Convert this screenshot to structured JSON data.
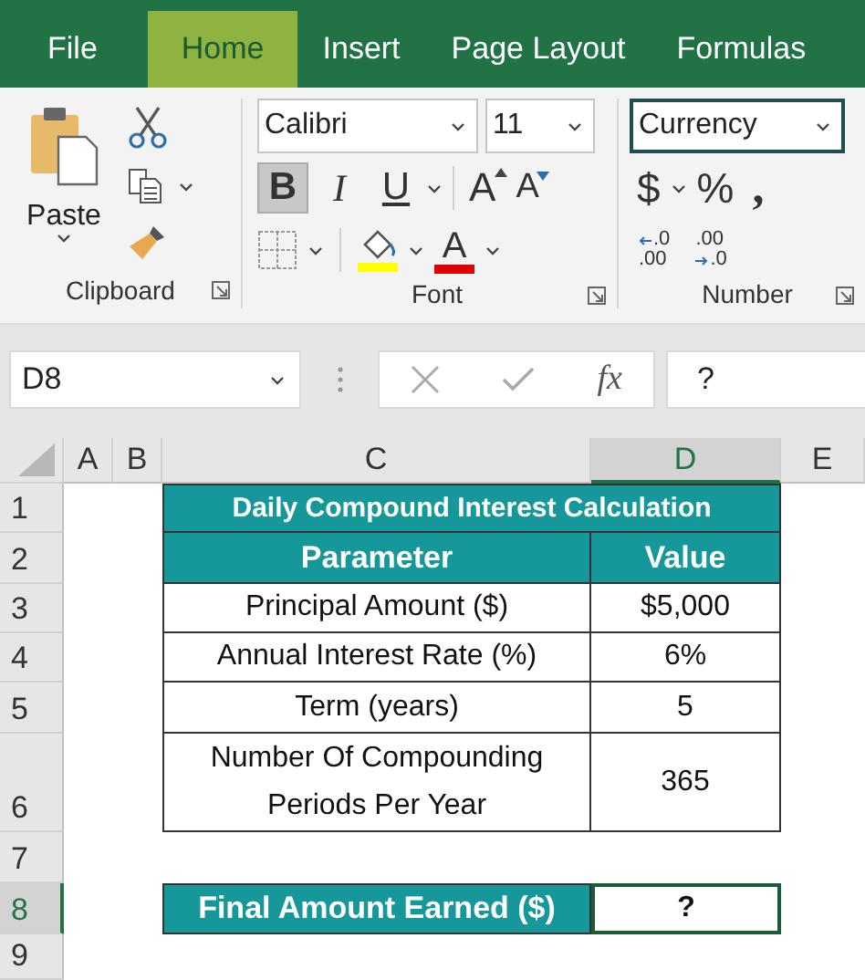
{
  "tabs": [
    {
      "label": "File",
      "selected": false
    },
    {
      "label": "Home",
      "selected": true
    },
    {
      "label": "Insert",
      "selected": false
    },
    {
      "label": "Page Layout",
      "selected": false
    },
    {
      "label": "Formulas",
      "selected": false
    }
  ],
  "ribbon": {
    "clipboard": {
      "paste_label": "Paste",
      "group_label": "Clipboard"
    },
    "font": {
      "font_name": "Calibri",
      "font_size": "11",
      "buttons": [
        {
          "kind": "bold",
          "label": "B",
          "selected": true
        },
        {
          "kind": "italic",
          "label": "I",
          "selected": false
        },
        {
          "kind": "underline",
          "label": "U",
          "selected": false
        }
      ],
      "grow_label": "A",
      "shrink_label": "A",
      "font_color_label": "A",
      "group_label": "Font"
    },
    "number": {
      "format": "Currency",
      "currency_symbol": "$",
      "percent_symbol": "%",
      "comma_symbol": ",",
      "decimal_buttons": [
        {
          "top": ".0",
          "bottom": ".00"
        },
        {
          "top": ".00",
          "bottom": ".0"
        }
      ],
      "group_label": "Number"
    }
  },
  "formula_bar": {
    "name_box": "D8",
    "function_label": "fx",
    "formula": "?"
  },
  "sheet": {
    "columns": [
      {
        "label": "A",
        "selected": false
      },
      {
        "label": "B",
        "selected": false
      },
      {
        "label": "C",
        "selected": false
      },
      {
        "label": "D",
        "selected": true
      },
      {
        "label": "E",
        "selected": false
      }
    ],
    "rows": [
      {
        "label": "1",
        "selected": false
      },
      {
        "label": "2",
        "selected": false
      },
      {
        "label": "3",
        "selected": false
      },
      {
        "label": "4",
        "selected": false
      },
      {
        "label": "5",
        "selected": false
      },
      {
        "label": "6",
        "selected": false
      },
      {
        "label": "7",
        "selected": false
      },
      {
        "label": "8",
        "selected": true
      },
      {
        "label": "9",
        "selected": false
      }
    ],
    "table": {
      "title": "Daily Compound Interest Calculation",
      "headers": [
        "Parameter",
        "Value"
      ],
      "rows": [
        {
          "parameter": "Principal Amount ($)",
          "value": "$5,000"
        },
        {
          "parameter": "Annual Interest Rate (%)",
          "value": "6%"
        },
        {
          "parameter": "Term (years)",
          "value": "5"
        },
        {
          "parameter": "Number Of Compounding Periods Per Year",
          "value": "365"
        }
      ]
    },
    "result": {
      "label": "Final Amount Earned ($)",
      "value": "?",
      "selected": true
    }
  }
}
